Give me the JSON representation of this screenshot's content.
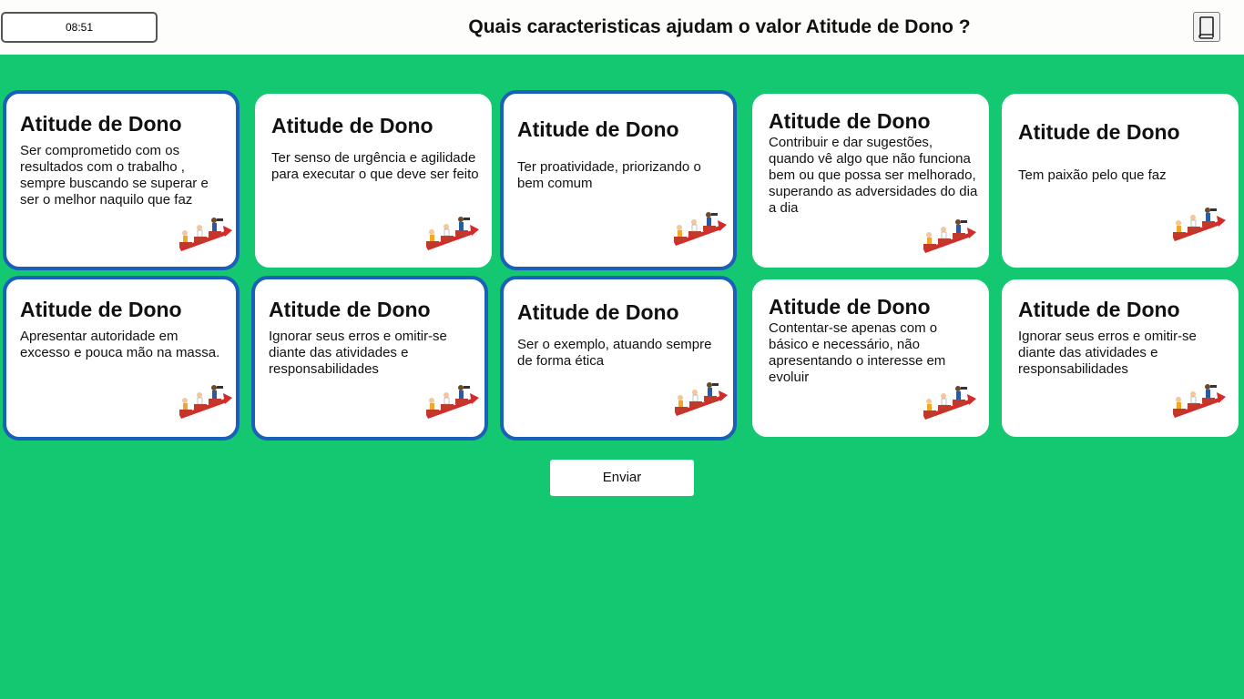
{
  "header": {
    "timer": "08:51",
    "question": "Quais caracteristicas ajudam o valor Atitude de Dono ?",
    "book_icon": "book-icon"
  },
  "cards": [
    {
      "title": "Atitude de Dono",
      "text": "Ser comprometido com os resultados com o trabalho , sempre buscando se superar e ser o melhor naquilo que faz",
      "selected": true
    },
    {
      "title": "Atitude de Dono",
      "text": "Ter senso de urgência e agilidade para executar o que deve ser feito",
      "selected": false
    },
    {
      "title": "Atitude de Dono",
      "text": "Ter proatividade, priorizando o bem comum",
      "selected": true
    },
    {
      "title": "Atitude de Dono",
      "text": "Contribuir e dar sugestões, quando vê algo que não funciona bem ou que possa ser melhorado, superando as adversidades do dia a dia",
      "selected": false
    },
    {
      "title": "Atitude de Dono",
      "text": "Tem paixão pelo que faz",
      "selected": false
    },
    {
      "title": "Atitude de Dono",
      "text": "Apresentar autoridade em excesso e pouca mão na massa.",
      "selected": true
    },
    {
      "title": "Atitude de Dono",
      "text": "Ignorar seus erros e omitir-se diante das atividades e responsabilidades",
      "selected": true
    },
    {
      "title": "Atitude de Dono",
      "text": "Ser o exemplo, atuando sempre de forma ética",
      "selected": true
    },
    {
      "title": "Atitude de Dono",
      "text": "Contentar-se apenas com o básico e necessário, não apresentando o interesse em evoluir",
      "selected": false
    },
    {
      "title": "Atitude de Dono",
      "text": "Ignorar seus erros e omitir-se diante das atividades e responsabilidades",
      "selected": false
    }
  ],
  "card_icon": "team-climbing-stairs-icon",
  "submit_label": "Enviar",
  "colors": {
    "background": "#13c870",
    "selected_border": "#1a5fb8",
    "card": "#ffffff"
  }
}
